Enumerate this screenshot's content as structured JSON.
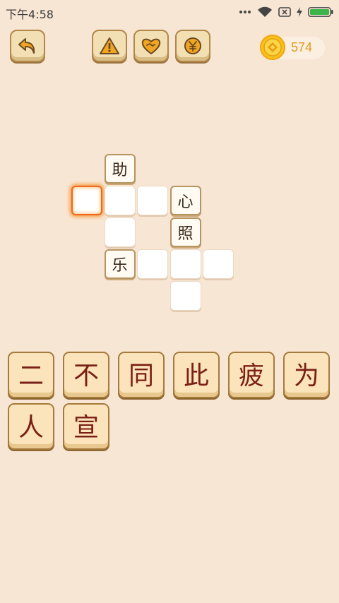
{
  "status_bar": {
    "time": "下午4:58",
    "icons": [
      "more-dots-icon",
      "wifi-icon",
      "sim-error-icon",
      "charging-bolt-icon",
      "battery-icon"
    ]
  },
  "toolbar": {
    "buttons": [
      {
        "name": "back-button",
        "icon": "undo-arrow-icon"
      },
      {
        "name": "warning-button",
        "icon": "warning-triangle-icon"
      },
      {
        "name": "share-button",
        "icon": "handshake-heart-icon"
      },
      {
        "name": "money-button",
        "icon": "yen-coin-icon"
      }
    ]
  },
  "coins": {
    "icon": "gold-coin-icon",
    "value": "574",
    "color": "#e09a1f"
  },
  "puzzle": {
    "cells": [
      {
        "row": 0,
        "col": 1,
        "char": "助"
      },
      {
        "row": 1,
        "col": 0,
        "char": "",
        "selected": true
      },
      {
        "row": 1,
        "col": 1,
        "char": ""
      },
      {
        "row": 1,
        "col": 2,
        "char": ""
      },
      {
        "row": 1,
        "col": 3,
        "char": "心"
      },
      {
        "row": 2,
        "col": 1,
        "char": ""
      },
      {
        "row": 2,
        "col": 3,
        "char": "照"
      },
      {
        "row": 3,
        "col": 1,
        "char": "乐"
      },
      {
        "row": 3,
        "col": 2,
        "char": ""
      },
      {
        "row": 3,
        "col": 3,
        "char": ""
      },
      {
        "row": 3,
        "col": 4,
        "char": ""
      },
      {
        "row": 4,
        "col": 3,
        "char": ""
      }
    ]
  },
  "answer_tiles": [
    "二",
    "不",
    "同",
    "此",
    "疲",
    "为",
    "人",
    "宣"
  ],
  "colors": {
    "background": "#f8e6d4",
    "tile_text": "#7a1f16",
    "selected_glow": "#ef6a20"
  }
}
